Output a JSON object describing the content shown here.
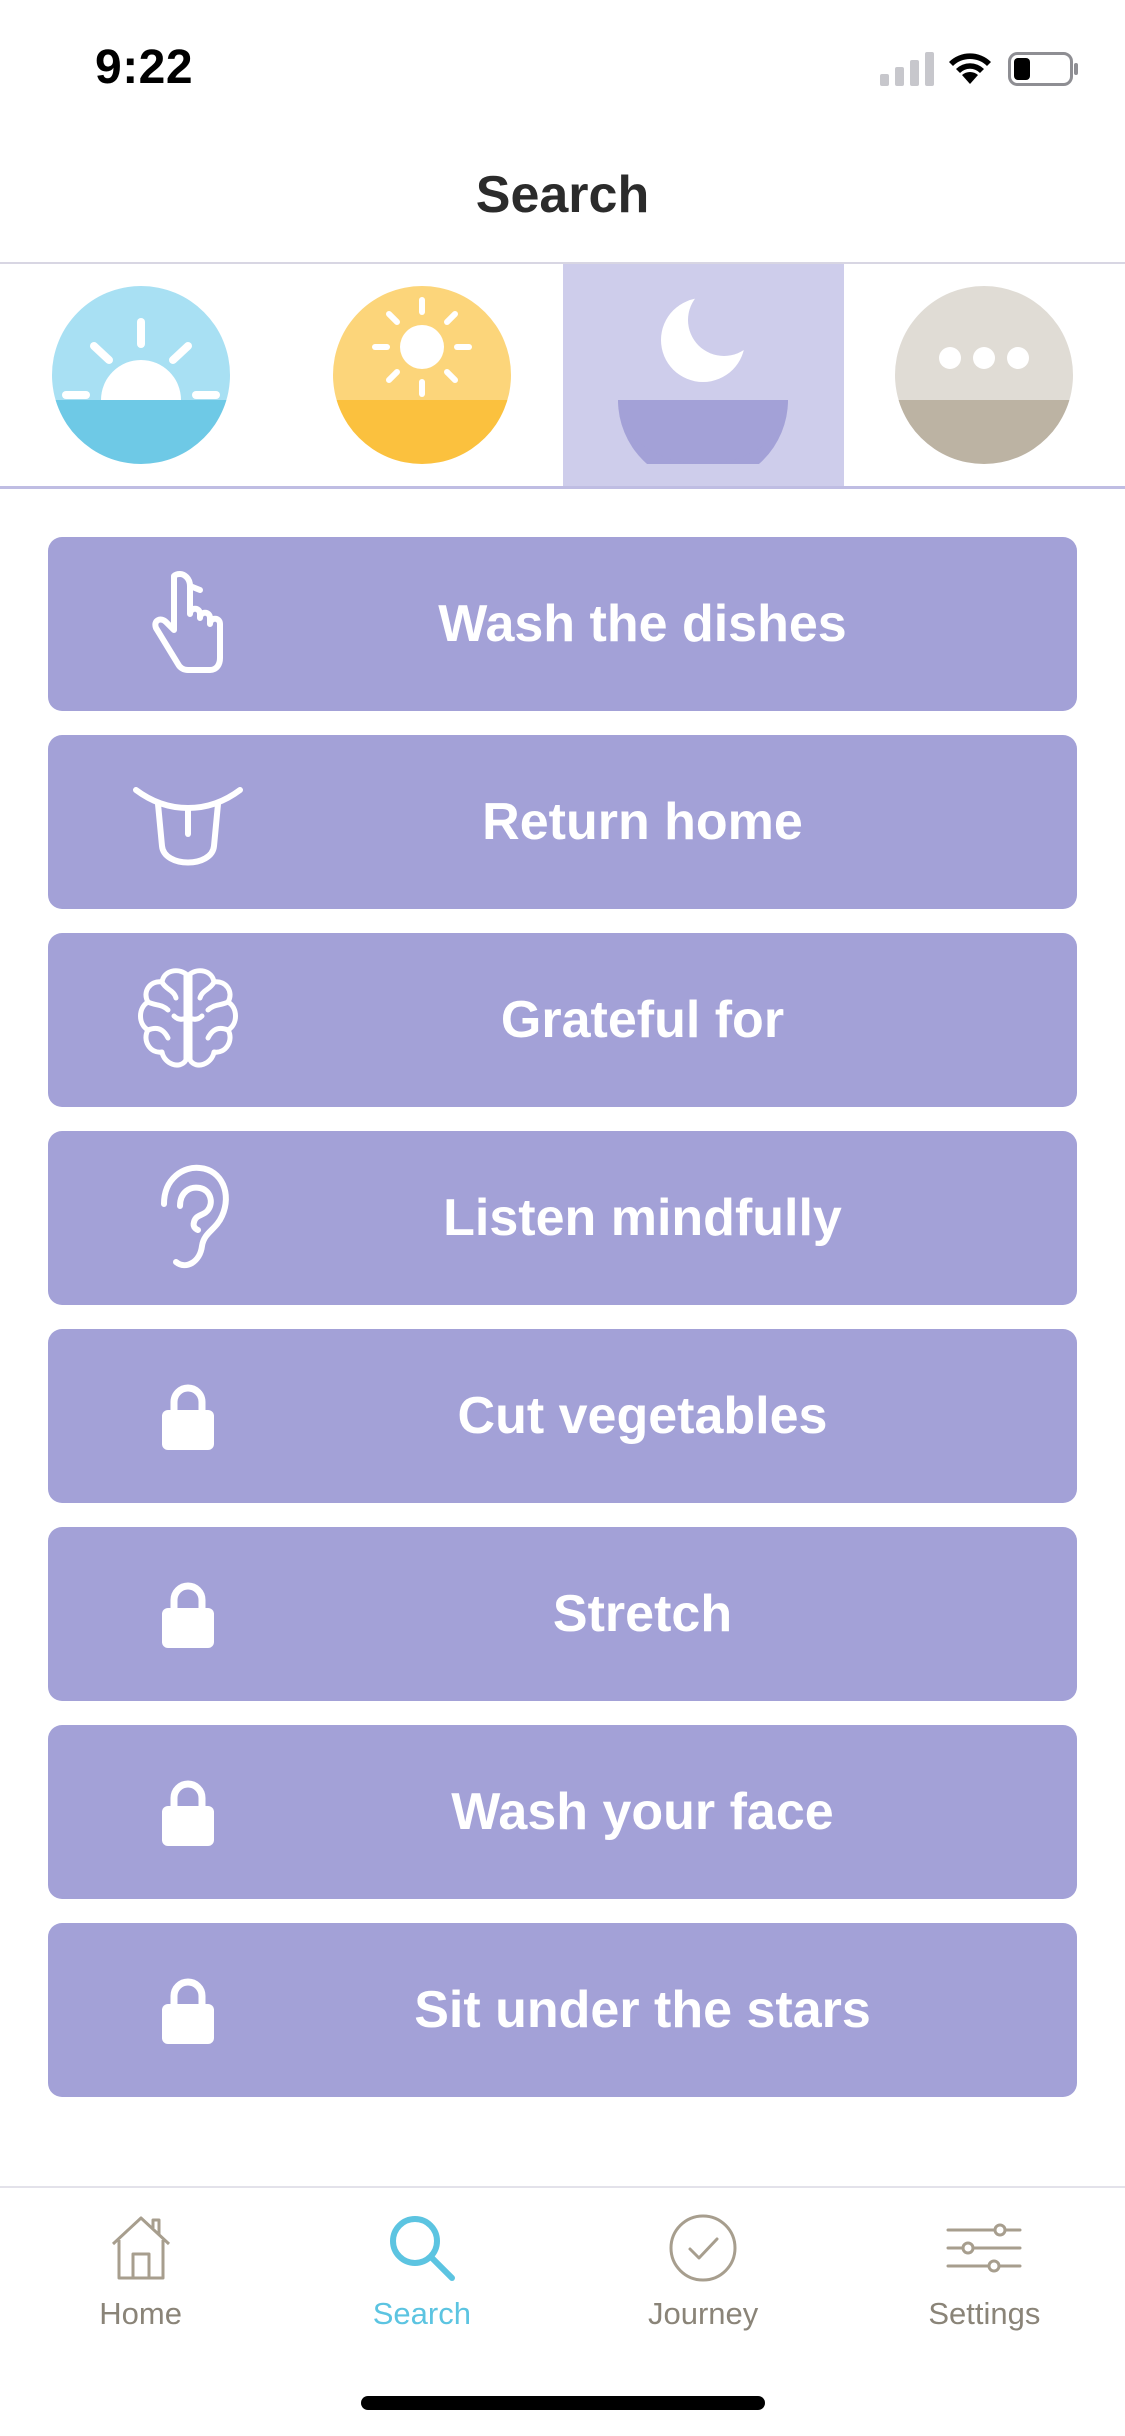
{
  "status_bar": {
    "time": "9:22"
  },
  "nav": {
    "title": "Search"
  },
  "time_of_day": [
    {
      "name": "sunrise",
      "icon": "sunrise-icon",
      "selected": false,
      "color": "#6ec9e6"
    },
    {
      "name": "day",
      "icon": "sun-icon",
      "selected": false,
      "color": "#fbc13e"
    },
    {
      "name": "night",
      "icon": "moon-icon",
      "selected": true,
      "color": "#a3a1d7"
    },
    {
      "name": "other",
      "icon": "ellipsis-icon",
      "selected": false,
      "color": "#bcb3a3"
    }
  ],
  "activities": [
    {
      "label": "Wash the dishes",
      "icon": "hand-pointer-icon",
      "locked": false
    },
    {
      "label": "Return home",
      "icon": "tongue-icon",
      "locked": false
    },
    {
      "label": "Grateful for",
      "icon": "brain-icon",
      "locked": false
    },
    {
      "label": "Listen mindfully",
      "icon": "ear-icon",
      "locked": false
    },
    {
      "label": "Cut vegetables",
      "icon": "lock-icon",
      "locked": true
    },
    {
      "label": "Stretch",
      "icon": "lock-icon",
      "locked": true
    },
    {
      "label": "Wash your face",
      "icon": "lock-icon",
      "locked": true
    },
    {
      "label": "Sit under the stars",
      "icon": "lock-icon",
      "locked": true
    }
  ],
  "tabbar": {
    "home": "Home",
    "search": "Search",
    "journey": "Journey",
    "settings": "Settings",
    "active": "search"
  },
  "colors": {
    "accent_tile": "#a3a1d7",
    "selected_bg": "#cecdeb",
    "active_tab": "#5cc4e1",
    "inactive_tab": "#8a8478"
  }
}
